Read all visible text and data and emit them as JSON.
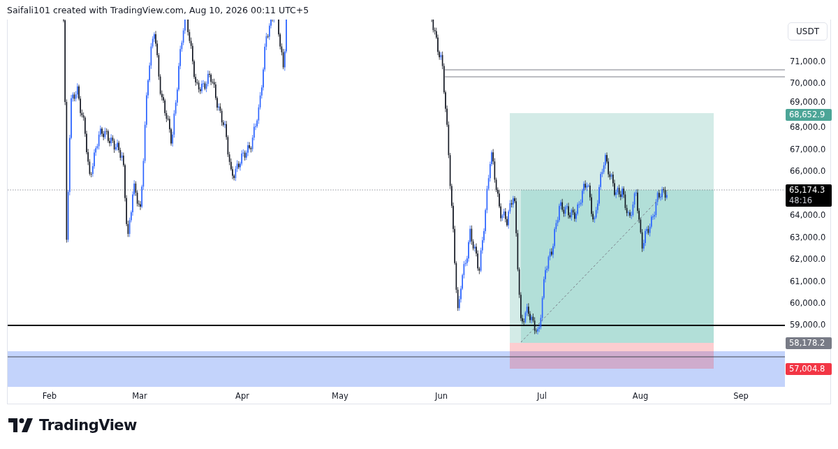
{
  "header": {
    "text": "Saifali101 created with TradingView.com, Aug 10, 2026 00:11 UTC+5"
  },
  "price_axis": {
    "currency": "USDT",
    "labels": [
      "71,000.0",
      "70,000.0",
      "69,000.0",
      "68,000.0",
      "67,000.0",
      "66,000.0",
      "64,000.0",
      "63,000.0",
      "62,000.0",
      "61,000.0",
      "60,000.0",
      "59,000.0"
    ],
    "badges": [
      {
        "kind": "target",
        "label": "68,652.9",
        "color": "#4ca597"
      },
      {
        "kind": "last",
        "label": "65,174.3",
        "countdown": "48:16",
        "color": "#000000"
      },
      {
        "kind": "entry",
        "label": "58,178.2",
        "color": "#787b86"
      },
      {
        "kind": "stop",
        "label": "57,004.8",
        "color": "#f23645"
      }
    ]
  },
  "time_axis": {
    "labels": [
      "Feb",
      "Mar",
      "Apr",
      "May",
      "Jun",
      "Jul",
      "Aug",
      "Sep"
    ]
  },
  "footer": {
    "logo_text": "TradingView"
  }
}
